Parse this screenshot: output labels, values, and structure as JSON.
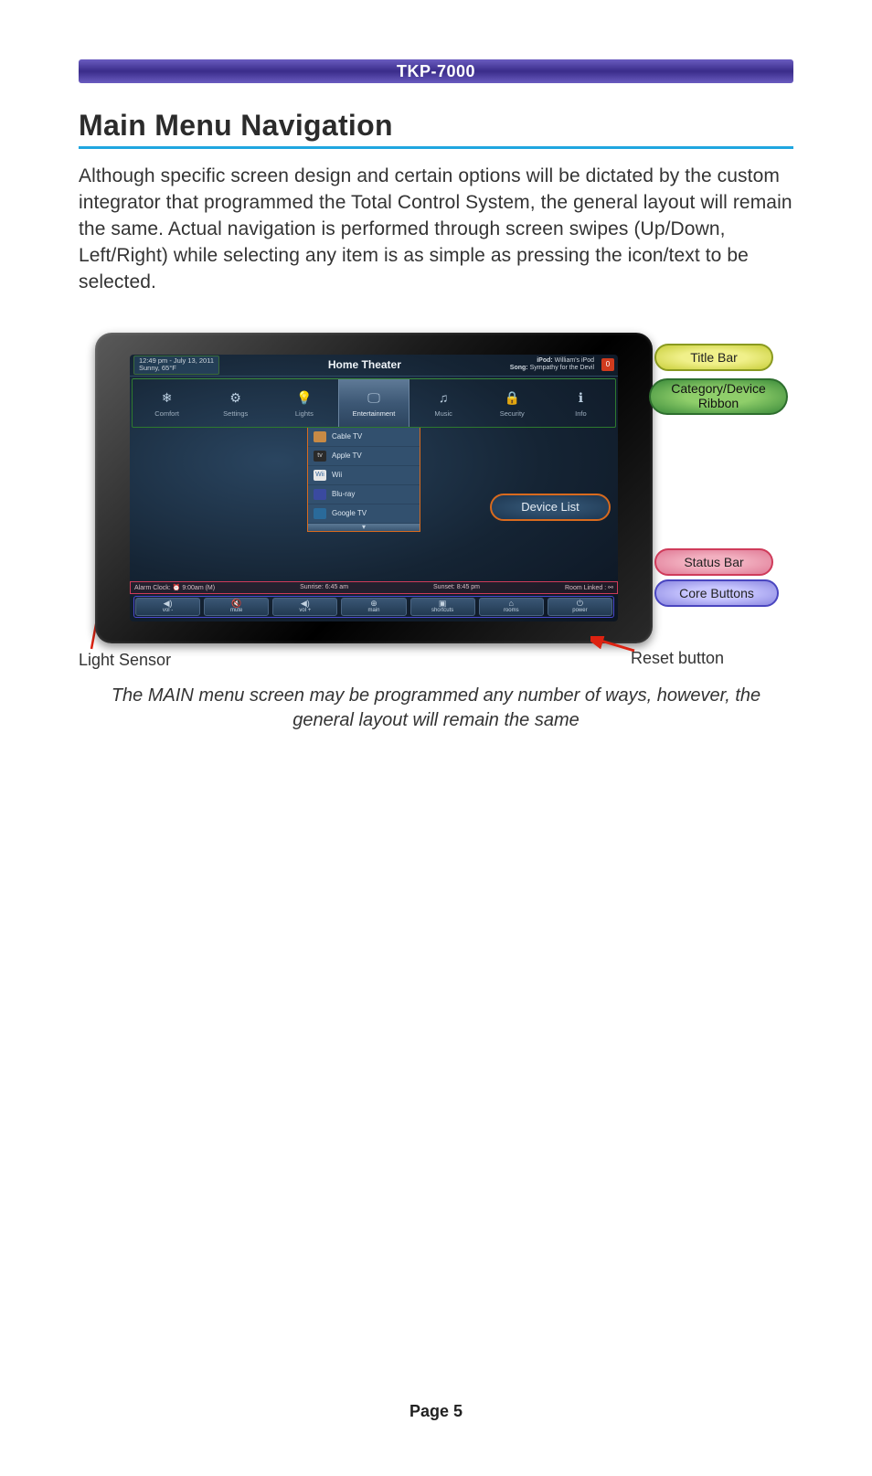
{
  "header": {
    "product": "TKP-7000"
  },
  "section": {
    "title": "Main Menu Navigation",
    "body": "Although specific screen design and certain options will be dictated by the custom integrator that programmed the Total Control System, the general layout will remain the same. Actual navigation is performed through screen swipes (Up/Down, Left/Right) while selecting any item is as simple as pressing the icon/text to be selected."
  },
  "screen": {
    "time": "12:49 pm - July 13, 2011",
    "weather": "Sunny, 65°F",
    "room": "Home Theater",
    "now_playing": {
      "line1_label": "iPod:",
      "line1_value": "William's iPod",
      "line2_label": "Song:",
      "line2_value": "Sympathy for the Devil",
      "badge": "0"
    },
    "ribbon": [
      {
        "label": "Comfort",
        "icon": "❄"
      },
      {
        "label": "Settings",
        "icon": "⚙"
      },
      {
        "label": "Lights",
        "icon": "💡"
      },
      {
        "label": "Entertainment",
        "icon": "🖵",
        "active": true
      },
      {
        "label": "Music",
        "icon": "♫"
      },
      {
        "label": "Security",
        "icon": "🔒"
      },
      {
        "label": "Info",
        "icon": "ℹ"
      }
    ],
    "device_list": [
      {
        "label": "Cable TV",
        "chip_bg": "#c88a45",
        "chip_fg": "#fff",
        "chip_text": ""
      },
      {
        "label": "Apple TV",
        "chip_bg": "#2a2a2a",
        "chip_fg": "#ccc",
        "chip_text": "tv"
      },
      {
        "label": "Wii",
        "chip_bg": "#e8e8e8",
        "chip_fg": "#3a6aa0",
        "chip_text": "Wii"
      },
      {
        "label": "Blu-ray",
        "chip_bg": "#3a4aa0",
        "chip_fg": "#fff",
        "chip_text": ""
      },
      {
        "label": "Google TV",
        "chip_bg": "#2a6a9a",
        "chip_fg": "#fff",
        "chip_text": ""
      }
    ],
    "status_bar": {
      "alarm_label": "Alarm Clock:",
      "alarm_value": "9:00am (M)",
      "sunrise_label": "Sunrise:",
      "sunrise_value": "6:45 am",
      "sunset_label": "Sunset:",
      "sunset_value": "8:45 pm",
      "room_linked": "Room Linked :"
    },
    "core_buttons": [
      {
        "label": "vol -",
        "icon": "◀)"
      },
      {
        "label": "mute",
        "icon": "🔇"
      },
      {
        "label": "vol +",
        "icon": "◀)"
      },
      {
        "label": "main",
        "icon": "⊕"
      },
      {
        "label": "shortcuts",
        "icon": "▣"
      },
      {
        "label": "rooms",
        "icon": "⌂"
      },
      {
        "label": "power",
        "icon": "⏻"
      }
    ]
  },
  "callouts": {
    "title_bar": "Title Bar",
    "ribbon_line1": "Category/Device",
    "ribbon_line2": "Ribbon",
    "device_list": "Device List",
    "status_bar": "Status Bar",
    "core_buttons": "Core Buttons"
  },
  "under_labels": {
    "light_sensor": "Light Sensor",
    "reset_button": "Reset button"
  },
  "caption": "The MAIN menu screen may be programmed any number of ways, however, the general layout will remain the same",
  "page_number": "Page 5"
}
